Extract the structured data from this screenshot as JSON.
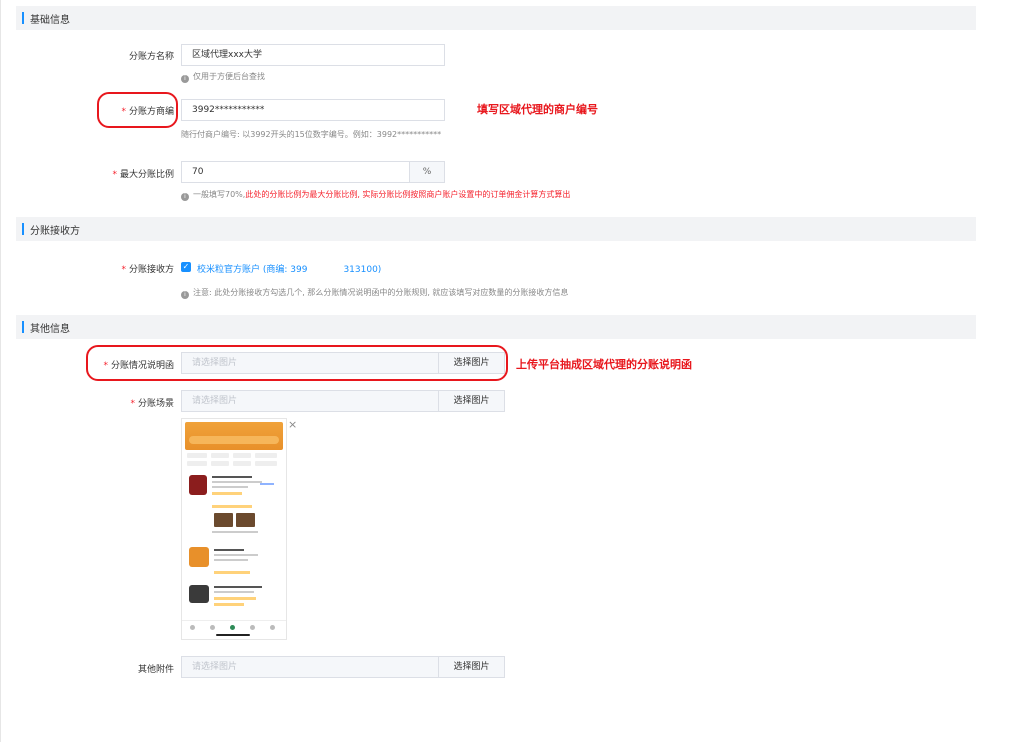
{
  "sections": {
    "basic": "基础信息",
    "receiver": "分账接收方",
    "other": "其他信息"
  },
  "fields": {
    "account_name": {
      "label": "分账方名称",
      "value": "区域代理xxx大学",
      "hint": "仅用于方便后台查找"
    },
    "merchant_no": {
      "required_mark": "*",
      "label": "分账方商编",
      "value": "3992***********",
      "hint": "随行付商户编号: 以3992开头的15位数字编号。例如：3992***********"
    },
    "max_ratio": {
      "required_mark": "*",
      "label": "最大分账比例",
      "value": "70",
      "suffix": "%",
      "hint_gray": "一般填写70%,",
      "hint_red": "此处的分账比例为最大分账比例, 实际分账比例按照商户账户设置中的订单佣金计算方式算出"
    },
    "receiver": {
      "required_mark": "*",
      "label": "分账接收方",
      "checked_symbol": "✓",
      "option_part1": "校米粒官方账户 (商编: 399",
      "option_part2": "313100)",
      "hint": "注意: 此处分账接收方勾选几个, 那么分账情况说明函中的分账规则, 就应该填写对应数量的分账接收方信息"
    },
    "explanation_letter": {
      "required_mark": "*",
      "label": "分账情况说明函",
      "placeholder": "请选择图片",
      "button": "选择图片"
    },
    "scene": {
      "required_mark": "*",
      "label": "分账场景",
      "placeholder": "请选择图片",
      "button": "选择图片",
      "remove_symbol": "×"
    },
    "attachments": {
      "label": "其他附件",
      "placeholder": "请选择图片",
      "button": "选择图片"
    }
  },
  "annotations": {
    "merchant_note": "填写区域代理的商户编号",
    "letter_note": "上传平台抽成区域代理的分账说明函"
  },
  "icons": {
    "info": "info-circle-icon",
    "info_symbol": "i",
    "check": "check-icon",
    "close": "close-icon"
  },
  "colors": {
    "accent": "#1890ff",
    "required": "#f5222d",
    "annotation": "#e8171d",
    "section_bg": "#f2f3f5"
  }
}
